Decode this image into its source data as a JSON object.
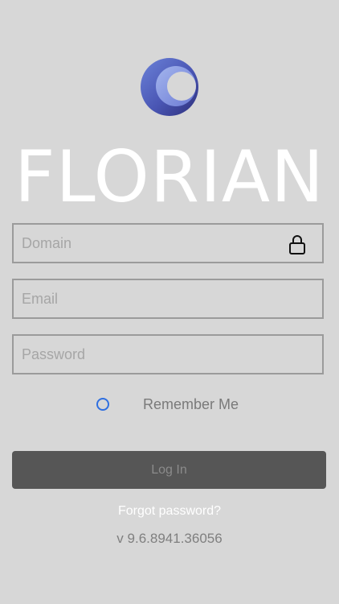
{
  "brand": {
    "name": "FLORIAN"
  },
  "form": {
    "domain_placeholder": "Domain",
    "email_placeholder": "Email",
    "password_placeholder": "Password",
    "remember_label": "Remember Me",
    "login_label": "Log In"
  },
  "links": {
    "forgot": "Forgot password?"
  },
  "footer": {
    "version": "v  9.6.8941.36056"
  },
  "colors": {
    "background": "#d7d7d7",
    "border": "#9b9b9b",
    "button": "#565656",
    "accent": "#2f6fe0"
  }
}
